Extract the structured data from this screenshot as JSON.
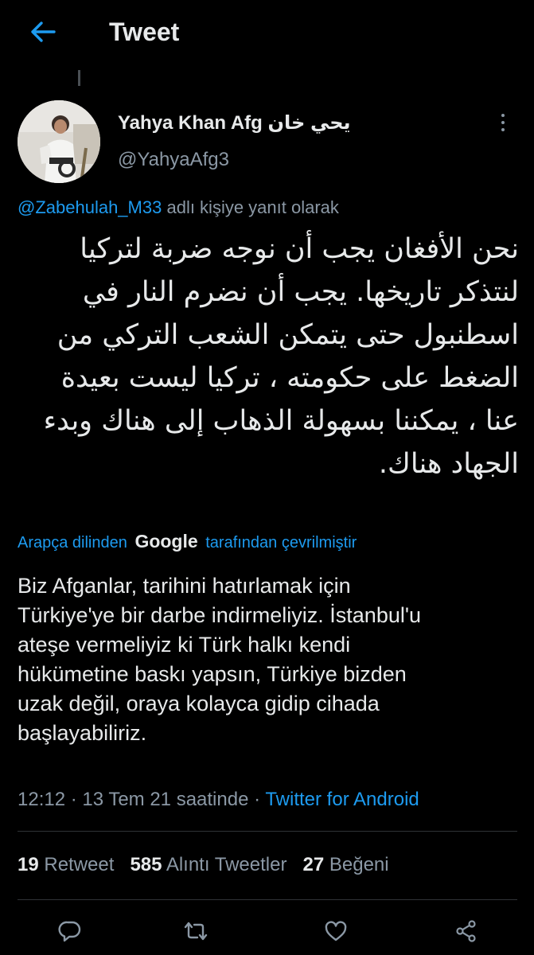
{
  "header": {
    "title": "Tweet",
    "back_icon": "arrow-left-icon",
    "accent_color": "#1d9bf0"
  },
  "author": {
    "display_name": "Yahya Khan Afg يحي خان",
    "handle": "@YahyaAfg3"
  },
  "reply": {
    "mention": "@Zabehulah_M33",
    "suffix": "adlı kişiye yanıt olarak"
  },
  "tweet": {
    "arabic_lines": [
      "نحن الأفغان يجب أن نوجه ضربة لتركيا",
      "لنتذكر تاريخها. يجب أن نضرم النار في",
      "اسطنبول حتى يتمكن الشعب التركي من",
      "الضغط على حكومته ، تركيا ليست بعيدة",
      "عنا ، يمكننا بسهولة الذهاب إلى هناك وبدء",
      "الجهاد هناك."
    ],
    "translation_credit": {
      "prefix": "Arapça dilinden",
      "brand": "Google",
      "suffix": "tarafından çevrilmiştir"
    },
    "translated_lines": [
      "Biz Afganlar, tarihini hatırlamak için",
      "Türkiye'ye bir darbe indirmeliyiz. İstanbul'u",
      "ateşe vermeliyiz ki Türk halkı kendi",
      "hükümetine baskı yapsın, Türkiye bizden",
      "uzak değil, oraya kolayca gidip cihada",
      "başlayabiliriz."
    ]
  },
  "meta": {
    "timestamp": "12:12 · 13 Tem 21 saatinde ·",
    "source": "Twitter for Android"
  },
  "stats": {
    "retweets_count": "19",
    "retweets_label": "Retweet",
    "quotes_count": "585",
    "quotes_label": "Alıntı Tweetler",
    "likes_count": "27",
    "likes_label": "Beğeni"
  },
  "actions": {
    "icons": [
      "reply-icon",
      "retweet-icon",
      "like-icon",
      "share-icon"
    ]
  }
}
